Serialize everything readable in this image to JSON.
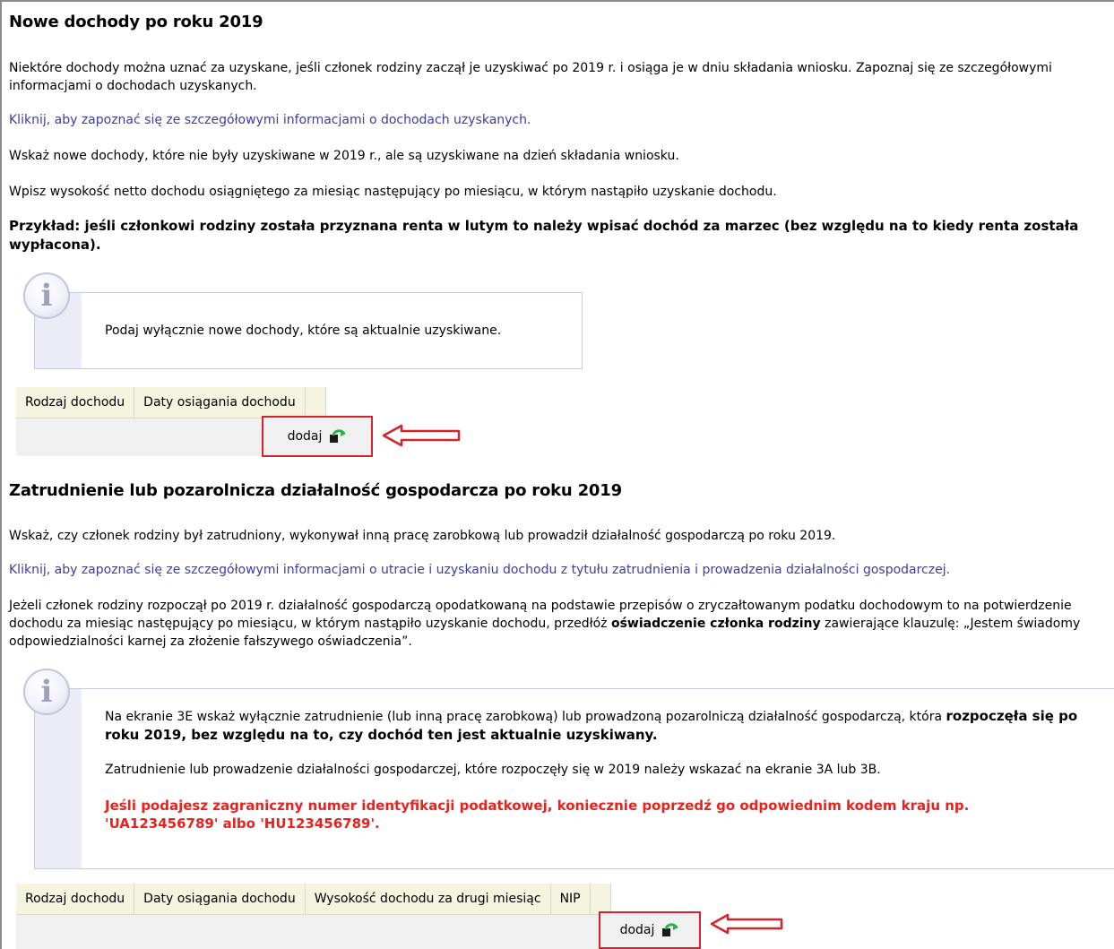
{
  "section1": {
    "title": "Nowe dochody po roku 2019",
    "paragraph1": "Niektóre dochody można uznać za uzyskane, jeśli członek rodziny zaczął je uzyskiwać po 2019 r. i osiąga je w dniu składania wniosku. Zapoznaj się ze szczegółowymi informacjami o dochodach uzyskanych.",
    "link": "Kliknij, aby zapoznać się ze szczegółowymi informacjami o dochodach uzyskanych.",
    "paragraph2": "Wskaż nowe dochody, które nie były uzyskiwane w 2019 r., ale są uzyskiwane na dzień składania wniosku.",
    "paragraph3": "Wpisz wysokość netto dochodu osiągniętego za miesiąc następujący po miesiącu, w którym nastąpiło uzyskanie dochodu.",
    "example": "Przykład: jeśli członkowi rodziny została przyznana renta w lutym to należy wpisać dochód za marzec (bez względu na to kiedy renta została wypłacona).",
    "info_text": "Podaj wyłącznie nowe dochody, które są aktualnie uzyskiwane.",
    "table": {
      "columns": [
        "Rodzaj dochodu",
        "Daty osiągania dochodu"
      ],
      "add_label": "dodaj"
    }
  },
  "section2": {
    "title": "Zatrudnienie lub pozarolnicza działalność gospodarcza po roku 2019",
    "paragraph1": "Wskaż, czy członek rodziny był zatrudniony, wykonywał inną pracę zarobkową lub prowadził działalność gospodarczą po roku 2019.",
    "link": "Kliknij, aby zapoznać się ze szczegółowymi informacjami o utracie i uzyskaniu dochodu z tytułu zatrudnienia i prowadzenia działalności gospodarczej.",
    "paragraph2_part1": "Jeżeli członek rodziny rozpoczął po 2019 r. działalność gospodarczą opodatkowaną na podstawie przepisów o zryczałtowanym podatku dochodowym to na potwierdzenie dochodu za miesiąc następujący po miesiącu, w którym nastąpiło uzyskanie dochodu, przedłóż ",
    "paragraph2_bold": "oświadczenie członka rodziny",
    "paragraph2_part2": " zawierające klauzulę: „Jestem świadomy odpowiedzialności karnej za złożenie fałszywego oświadczenia”.",
    "info": {
      "line1_part1": "Na ekranie 3E wskaż wyłącznie zatrudnienie (lub inną pracę zarobkową) lub prowadzoną pozarolniczą działalność gospodarczą, która ",
      "line1_bold": "rozpoczęła się po roku 2019, bez względu na to, czy dochód ten jest aktualnie uzyskiwany.",
      "line2": "Zatrudnienie lub prowadzenie działalności gospodarczej, które rozpoczęły się w 2019 należy wskazać na ekranie 3A lub 3B.",
      "warning": "Jeśli podajesz zagraniczny numer identyfikacji podatkowej, koniecznie poprzedź go odpowiednim kodem kraju np. 'UA123456789' albo 'HU123456789'."
    },
    "table": {
      "columns": [
        "Rodzaj dochodu",
        "Daty osiągania dochodu",
        "Wysokość dochodu za drugi miesiąc",
        "NIP"
      ],
      "add_label": "dodaj"
    }
  },
  "icons": {
    "info": "info-icon",
    "add": "add-undo-icon",
    "arrow": "red-arrow-left-icon"
  },
  "colors": {
    "link": "#3d3d9e",
    "warning": "#e8231f",
    "highlight": "#d4232a",
    "table_header": "#f4f4e0"
  }
}
